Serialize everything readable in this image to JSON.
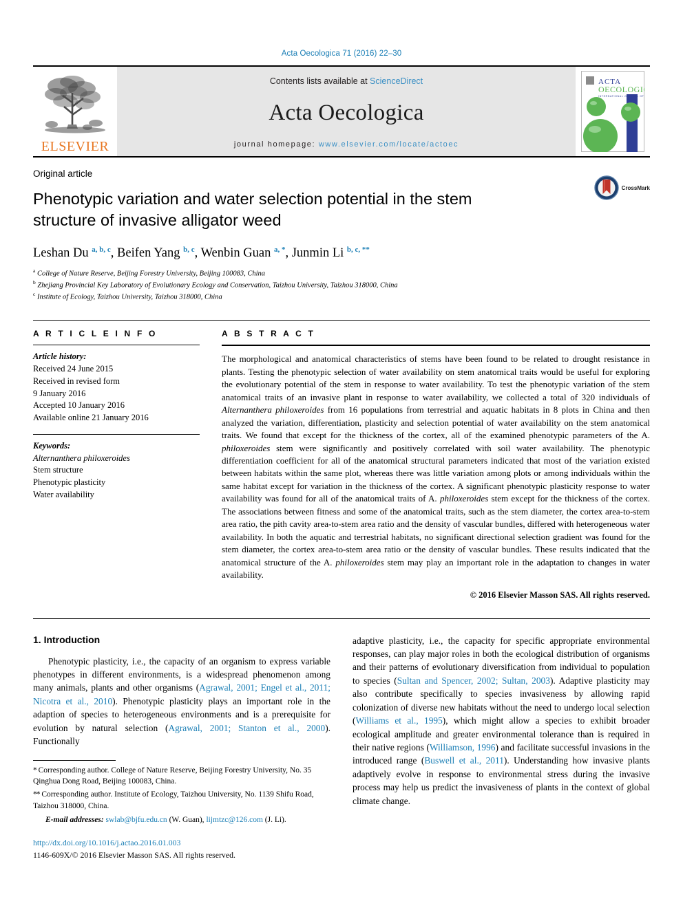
{
  "running_head": "Acta Oecologica 71 (2016) 22–30",
  "masthead": {
    "publisher_name": "ELSEVIER",
    "contents_prefix": "Contents lists available at ",
    "contents_link": "ScienceDirect",
    "journal_title": "Acta Oecologica",
    "homepage_prefix": "journal homepage:",
    "homepage_url": "www.elsevier.com/locate/actoec",
    "cover": {
      "line1": "ACTA",
      "line2": "OECOLOGICA",
      "line3": "INTERNATIONAL JOURNAL OF ECOLOGY"
    }
  },
  "title_block": {
    "article_type": "Original article",
    "title": "Phenotypic variation and water selection potential in the stem structure of invasive alligator weed",
    "crossmark_label": "CrossMark",
    "authors": [
      {
        "name": "Leshan Du",
        "sup": "a, b, c",
        "sep": ", "
      },
      {
        "name": "Beifen Yang",
        "sup": "b, c",
        "sep": ", "
      },
      {
        "name": "Wenbin Guan",
        "sup": "a, *",
        "sep": ", "
      },
      {
        "name": "Junmin Li",
        "sup": "b, c, **",
        "sep": ""
      }
    ],
    "affiliations": [
      {
        "marker": "a",
        "text": "College of Nature Reserve, Beijing Forestry University, Beijing 100083, China"
      },
      {
        "marker": "b",
        "text": "Zhejiang Provincial Key Laboratory of Evolutionary Ecology and Conservation, Taizhou University, Taizhou 318000, China"
      },
      {
        "marker": "c",
        "text": "Institute of Ecology, Taizhou University, Taizhou 318000, China"
      }
    ]
  },
  "article_info": {
    "heading": "A R T I C L E  I N F O",
    "history_label": "Article history:",
    "history": [
      "Received 24 June 2015",
      "Received in revised form",
      "9 January 2016",
      "Accepted 10 January 2016",
      "Available online 21 January 2016"
    ],
    "keywords_label": "Keywords:",
    "keywords": [
      "Alternanthera philoxeroides",
      "Stem structure",
      "Phenotypic plasticity",
      "Water availability"
    ]
  },
  "abstract": {
    "heading": "A B S T R A C T",
    "paragraph_1": "The morphological and anatomical characteristics of stems have been found to be related to drought resistance in plants. Testing the phenotypic selection of water availability on stem anatomical traits would be useful for exploring the evolutionary potential of the stem in response to water availability. To test the phenotypic variation of the stem anatomical traits of an invasive plant in response to water availability, we collected a total of 320 individuals of ",
    "species_1": "Alternanthera philoxeroides",
    "paragraph_2": " from 16 populations from terrestrial and aquatic habitats in 8 plots in China and then analyzed the variation, differentiation, plasticity and selection potential of water availability on the stem anatomical traits. We found that except for the thickness of the cortex, all of the examined phenotypic parameters of the A. ",
    "species_2": "philoxeroides",
    "paragraph_3": " stem were significantly and positively correlated with soil water availability. The phenotypic differentiation coefficient for all of the anatomical structural parameters indicated that most of the variation existed between habitats within the same plot, whereas there was little variation among plots or among individuals within the same habitat except for variation in the thickness of the cortex. A significant phenotypic plasticity response to water availability was found for all of the anatomical traits of A. ",
    "species_3": "philoxeroides",
    "paragraph_4": " stem except for the thickness of the cortex. The associations between fitness and some of the anatomical traits, such as the stem diameter, the cortex area-to-stem area ratio, the pith cavity area-to-stem area ratio and the density of vascular bundles, differed with heterogeneous water availability. In both the aquatic and terrestrial habitats, no significant directional selection gradient was found for the stem diameter, the cortex area-to-stem area ratio or the density of vascular bundles. These results indicated that the anatomical structure of the A. ",
    "species_4": "philoxeroides",
    "paragraph_5": " stem may play an important role in the adaptation to changes in water availability.",
    "copyright": "© 2016 Elsevier Masson SAS. All rights reserved."
  },
  "introduction": {
    "section_title": "1. Introduction",
    "left_col": {
      "part_1": "Phenotypic plasticity, i.e., the capacity of an organism to express variable phenotypes in different environments, is a widespread phenomenon among many animals, plants and other organisms (",
      "ref_1": "Agrawal, 2001; Engel et al., 2011; Nicotra et al., 2010",
      "part_2": "). Phenotypic plasticity plays an important role in the adaption of species to heterogeneous environments and is a prerequisite for evolution by natural selection (",
      "ref_2": "Agrawal, 2001; Stanton et al., 2000",
      "part_3": "). Functionally"
    },
    "right_col": {
      "part_1": "adaptive plasticity, i.e., the capacity for specific appropriate environmental responses, can play major roles in both the ecological distribution of organisms and their patterns of evolutionary diversification from individual to population to species (",
      "ref_1": "Sultan and Spencer, 2002; Sultan, 2003",
      "part_2": "). Adaptive plasticity may also contribute specifically to species invasiveness by allowing rapid colonization of diverse new habitats without the need to undergo local selection (",
      "ref_2": "Williams et al., 1995",
      "part_3": "), which might allow a species to exhibit broader ecological amplitude and greater environmental tolerance than is required in their native regions (",
      "ref_3": "Williamson, 1996",
      "part_4": ") and facilitate successful invasions in the introduced range (",
      "ref_4": "Buswell et al., 2011",
      "part_5": "). Understanding how invasive plants adaptively evolve in response to environmental stress during the invasive process may help us predict the invasiveness of plants in the context of global climate change."
    }
  },
  "footnotes": {
    "corr_1_marker": "*",
    "corr_1": "Corresponding author. College of Nature Reserve, Beijing Forestry University, No. 35 Qinghua Dong Road, Beijing 100083, China.",
    "corr_2_marker": "**",
    "corr_2": "Corresponding author. Institute of Ecology, Taizhou University, No. 1139 Shifu Road, Taizhou 318000, China.",
    "email_label": "E-mail addresses:",
    "email_1": "swlab@bjfu.edu.cn",
    "email_1_who": " (W. Guan), ",
    "email_2": "lijmtzc@126.com",
    "email_2_who": " (J. Li).",
    "doi": "http://dx.doi.org/10.1016/j.actao.2016.01.003",
    "issn": "1146-609X/© 2016 Elsevier Masson SAS. All rights reserved."
  },
  "colors": {
    "link_blue": "#1a7eb5",
    "elsevier_orange": "#E87722",
    "band_gray": "#e6e6e6",
    "cover_green": "#5cb554",
    "cover_blue": "#2f3f96",
    "crossmark_red": "#c0342a",
    "crossmark_ring": "#1c3f6e"
  }
}
